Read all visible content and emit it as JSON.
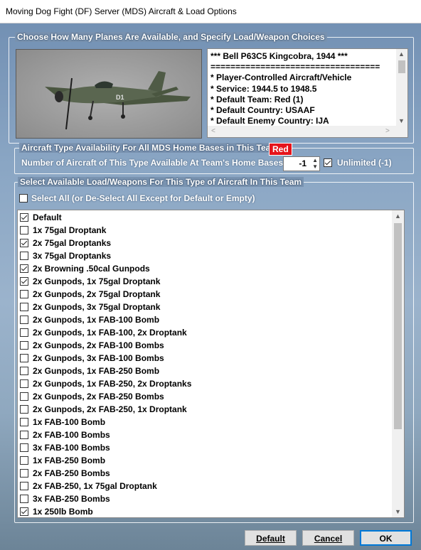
{
  "window": {
    "title": "Moving Dog Fight (DF) Server (MDS)  Aircraft & Load Options"
  },
  "group_planes": {
    "legend": "Choose How Many Planes Are Available, and Specify Load/Weapon Choices"
  },
  "aircraft_image": {
    "nose_marking": "D1"
  },
  "info_lines": [
    "*** Bell P63C5 Kingcobra, 1944 ***",
    "==================================",
    "* Player-Controlled Aircraft/Vehicle",
    "* Service: 1944.5 to 1948.5",
    "* Default Team: Red (1)",
    "* Default Country: USAAF",
    "* Default Enemy Country: IJA"
  ],
  "group_availability": {
    "legend": "Aircraft Type Availability For All MDS Home Bases in This Team:",
    "team_badge": "Red",
    "team_color": "#e5141b",
    "count_label": "Number of Aircraft of This Type Available At Team's Home Bases:",
    "count_value": "-1",
    "unlimited_label": "Unlimited (-1)",
    "unlimited_checked": true
  },
  "group_loads": {
    "legend": "Select Available Load/Weapons For This Type of Aircraft In This Team",
    "select_all_label": "Select All (or De-Select All Except for Default or Empty)",
    "select_all_checked": false
  },
  "loads": [
    {
      "label": "Default",
      "checked": true
    },
    {
      "label": "1x 75gal Droptank",
      "checked": false
    },
    {
      "label": "2x 75gal Droptanks",
      "checked": true
    },
    {
      "label": "3x 75gal Droptanks",
      "checked": false
    },
    {
      "label": "2x Browning .50cal Gunpods",
      "checked": true
    },
    {
      "label": "2x Gunpods, 1x 75gal Droptank",
      "checked": true
    },
    {
      "label": "2x Gunpods, 2x 75gal Droptank",
      "checked": false
    },
    {
      "label": "2x Gunpods, 3x 75gal Droptank",
      "checked": false
    },
    {
      "label": "2x Gunpods, 1x FAB-100 Bomb",
      "checked": false
    },
    {
      "label": "2x Gunpods, 1x FAB-100, 2x Droptank",
      "checked": false
    },
    {
      "label": "2x Gunpods, 2x FAB-100 Bombs",
      "checked": false
    },
    {
      "label": "2x Gunpods, 3x FAB-100 Bombs",
      "checked": false
    },
    {
      "label": "2x Gunpods, 1x FAB-250 Bomb",
      "checked": false
    },
    {
      "label": "2x Gunpods, 1x FAB-250, 2x Droptanks",
      "checked": false
    },
    {
      "label": "2x Gunpods, 2x FAB-250 Bombs",
      "checked": false
    },
    {
      "label": "2x Gunpods, 2x FAB-250, 1x Droptank",
      "checked": false
    },
    {
      "label": "1x FAB-100 Bomb",
      "checked": false
    },
    {
      "label": "2x FAB-100 Bombs",
      "checked": false
    },
    {
      "label": "3x FAB-100 Bombs",
      "checked": false
    },
    {
      "label": "1x FAB-250 Bomb",
      "checked": false
    },
    {
      "label": "2x FAB-250 Bombs",
      "checked": false
    },
    {
      "label": "2x FAB-250, 1x 75gal Droptank",
      "checked": false
    },
    {
      "label": "3x FAB-250 Bombs",
      "checked": false
    },
    {
      "label": "1x 250lb Bomb",
      "checked": true
    }
  ],
  "buttons": {
    "default": "Default",
    "cancel": "Cancel",
    "ok": "OK"
  }
}
